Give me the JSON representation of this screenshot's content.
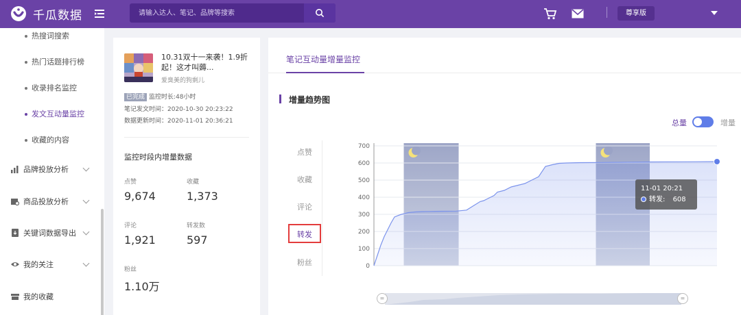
{
  "app": {
    "name": "千瓜数据"
  },
  "search": {
    "placeholder": "请输入达人、笔记、品牌等搜索"
  },
  "header": {
    "vip_label": "尊享版"
  },
  "icons": {
    "logo": "logo-icon",
    "menu": "menu-toggle-icon",
    "search": "search-icon",
    "cart": "cart-icon",
    "mail": "mail-icon",
    "dropdown": "chevron-down-icon",
    "moon": "moon-icon"
  },
  "sidebar": {
    "sub_items": [
      {
        "label": "热搜词搜索"
      },
      {
        "label": "热门话题排行榜"
      },
      {
        "label": "收录排名监控"
      },
      {
        "label": "发文互动量监控",
        "active": true
      },
      {
        "label": "收藏的内容"
      }
    ],
    "main_items": [
      {
        "label": "品牌投放分析",
        "icon": "chart-icon"
      },
      {
        "label": "商品投放分析",
        "icon": "product-icon"
      },
      {
        "label": "关键词数据导出",
        "icon": "export-icon"
      },
      {
        "label": "我的关注",
        "icon": "eye-icon"
      },
      {
        "label": "我的收藏",
        "icon": "folder-icon"
      }
    ]
  },
  "note": {
    "title": "10.31双十一来袭！1.9折起！这才叫薅...",
    "author": "爱臭美的狗剩儿",
    "status": "已完成",
    "duration": "监控时长:48小时",
    "published": "笔记发文时间：2020-10-30 20:23:22",
    "updated": "数据更新时间：2020-11-01 20:36:21",
    "section_title": "监控时段内增量数据",
    "stats": [
      {
        "label": "点赞",
        "value": "9,674"
      },
      {
        "label": "收藏",
        "value": "1,373"
      },
      {
        "label": "评论",
        "value": "1,921"
      },
      {
        "label": "转发数",
        "value": "597"
      },
      {
        "label": "粉丝",
        "value": "1.10万"
      }
    ]
  },
  "panel": {
    "tab": "笔记互动量增量监控",
    "trend_title": "增量趋势图",
    "toggle_total": "总量",
    "toggle_increment": "增量",
    "toggle_on": true,
    "metrics": [
      {
        "label": "点赞"
      },
      {
        "label": "收藏"
      },
      {
        "label": "评论"
      },
      {
        "label": "转发",
        "active": true
      },
      {
        "label": "粉丝"
      }
    ],
    "tooltip": {
      "time": "11-01 20:21",
      "series": "转发:",
      "value": "608"
    }
  },
  "colors": {
    "brand": "#6a42a6",
    "line": "#5f7de8",
    "night": "#9ba5c7"
  },
  "chart_data": {
    "type": "area",
    "y_ticks": [
      "700",
      "600",
      "500",
      "400",
      "300",
      "200",
      "100",
      "0"
    ],
    "ylim": [
      0,
      700
    ],
    "grid": true,
    "series": [
      {
        "x": [
          0,
          0.01,
          0.02,
          0.03,
          0.04,
          0.05,
          0.06,
          0.07,
          0.08,
          0.09,
          0.1,
          0.12,
          0.14,
          0.16,
          0.2,
          0.24,
          0.27,
          0.29,
          0.31,
          0.32,
          0.33,
          0.35,
          0.36,
          0.38,
          0.4,
          0.42,
          0.44,
          0.46,
          0.48,
          0.5,
          0.52,
          0.54,
          0.56,
          0.6,
          0.66,
          0.72,
          0.8,
          0.9,
          1.0
        ],
        "values": [
          0,
          60,
          120,
          170,
          210,
          250,
          285,
          293,
          300,
          305,
          310,
          314,
          316,
          317,
          318,
          319,
          325,
          350,
          375,
          380,
          390,
          410,
          430,
          440,
          460,
          470,
          480,
          500,
          520,
          580,
          590,
          598,
          600,
          602,
          603,
          604,
          606,
          607,
          608
        ]
      }
    ],
    "night_bands": [
      [
        0.087,
        0.247
      ],
      [
        0.647,
        0.804
      ]
    ]
  }
}
